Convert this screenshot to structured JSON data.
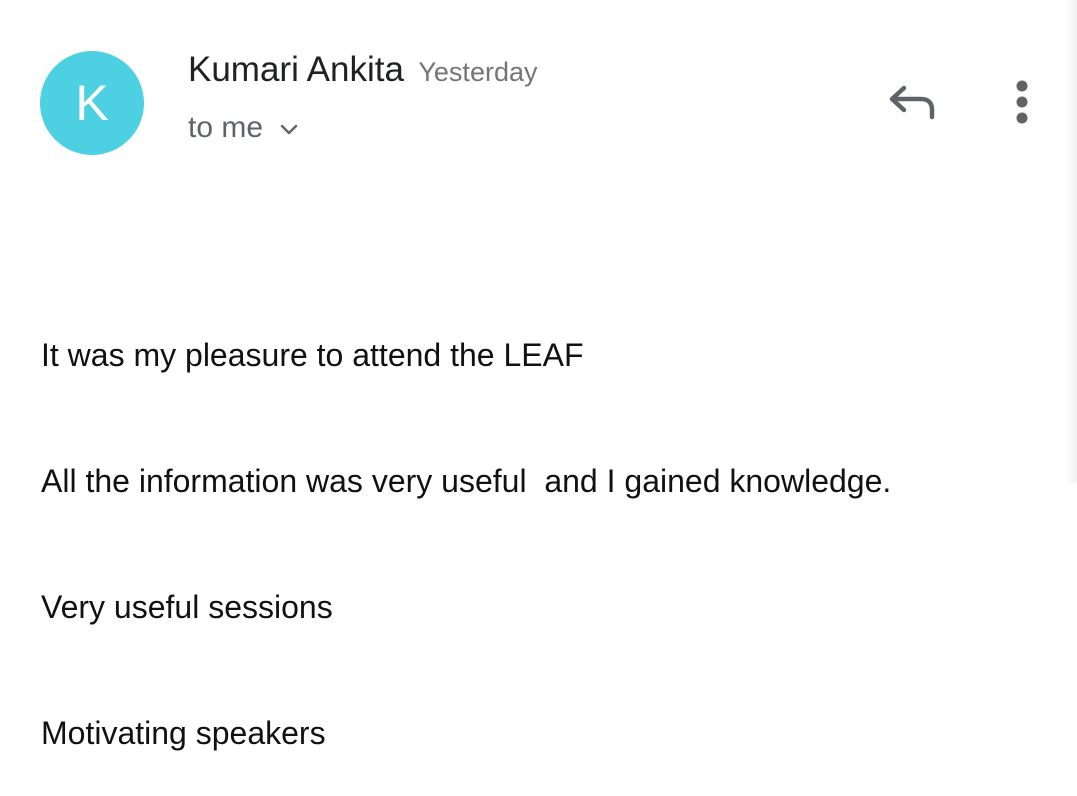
{
  "message": {
    "sender": {
      "avatar_letter": "K",
      "avatar_color": "#4dd0e1",
      "name": "Kumari Ankita",
      "timestamp": "Yesterday"
    },
    "recipient_label": "to me",
    "actions": {
      "reply_icon": "reply-icon",
      "more_icon": "more-vertical-icon",
      "expand_icon": "chevron-down-icon"
    },
    "body_lines": [
      "It was my pleasure to attend the LEAF",
      "All the information was very useful  and I gained knowledge.",
      "Very useful sessions",
      "Motivating speakers"
    ]
  }
}
